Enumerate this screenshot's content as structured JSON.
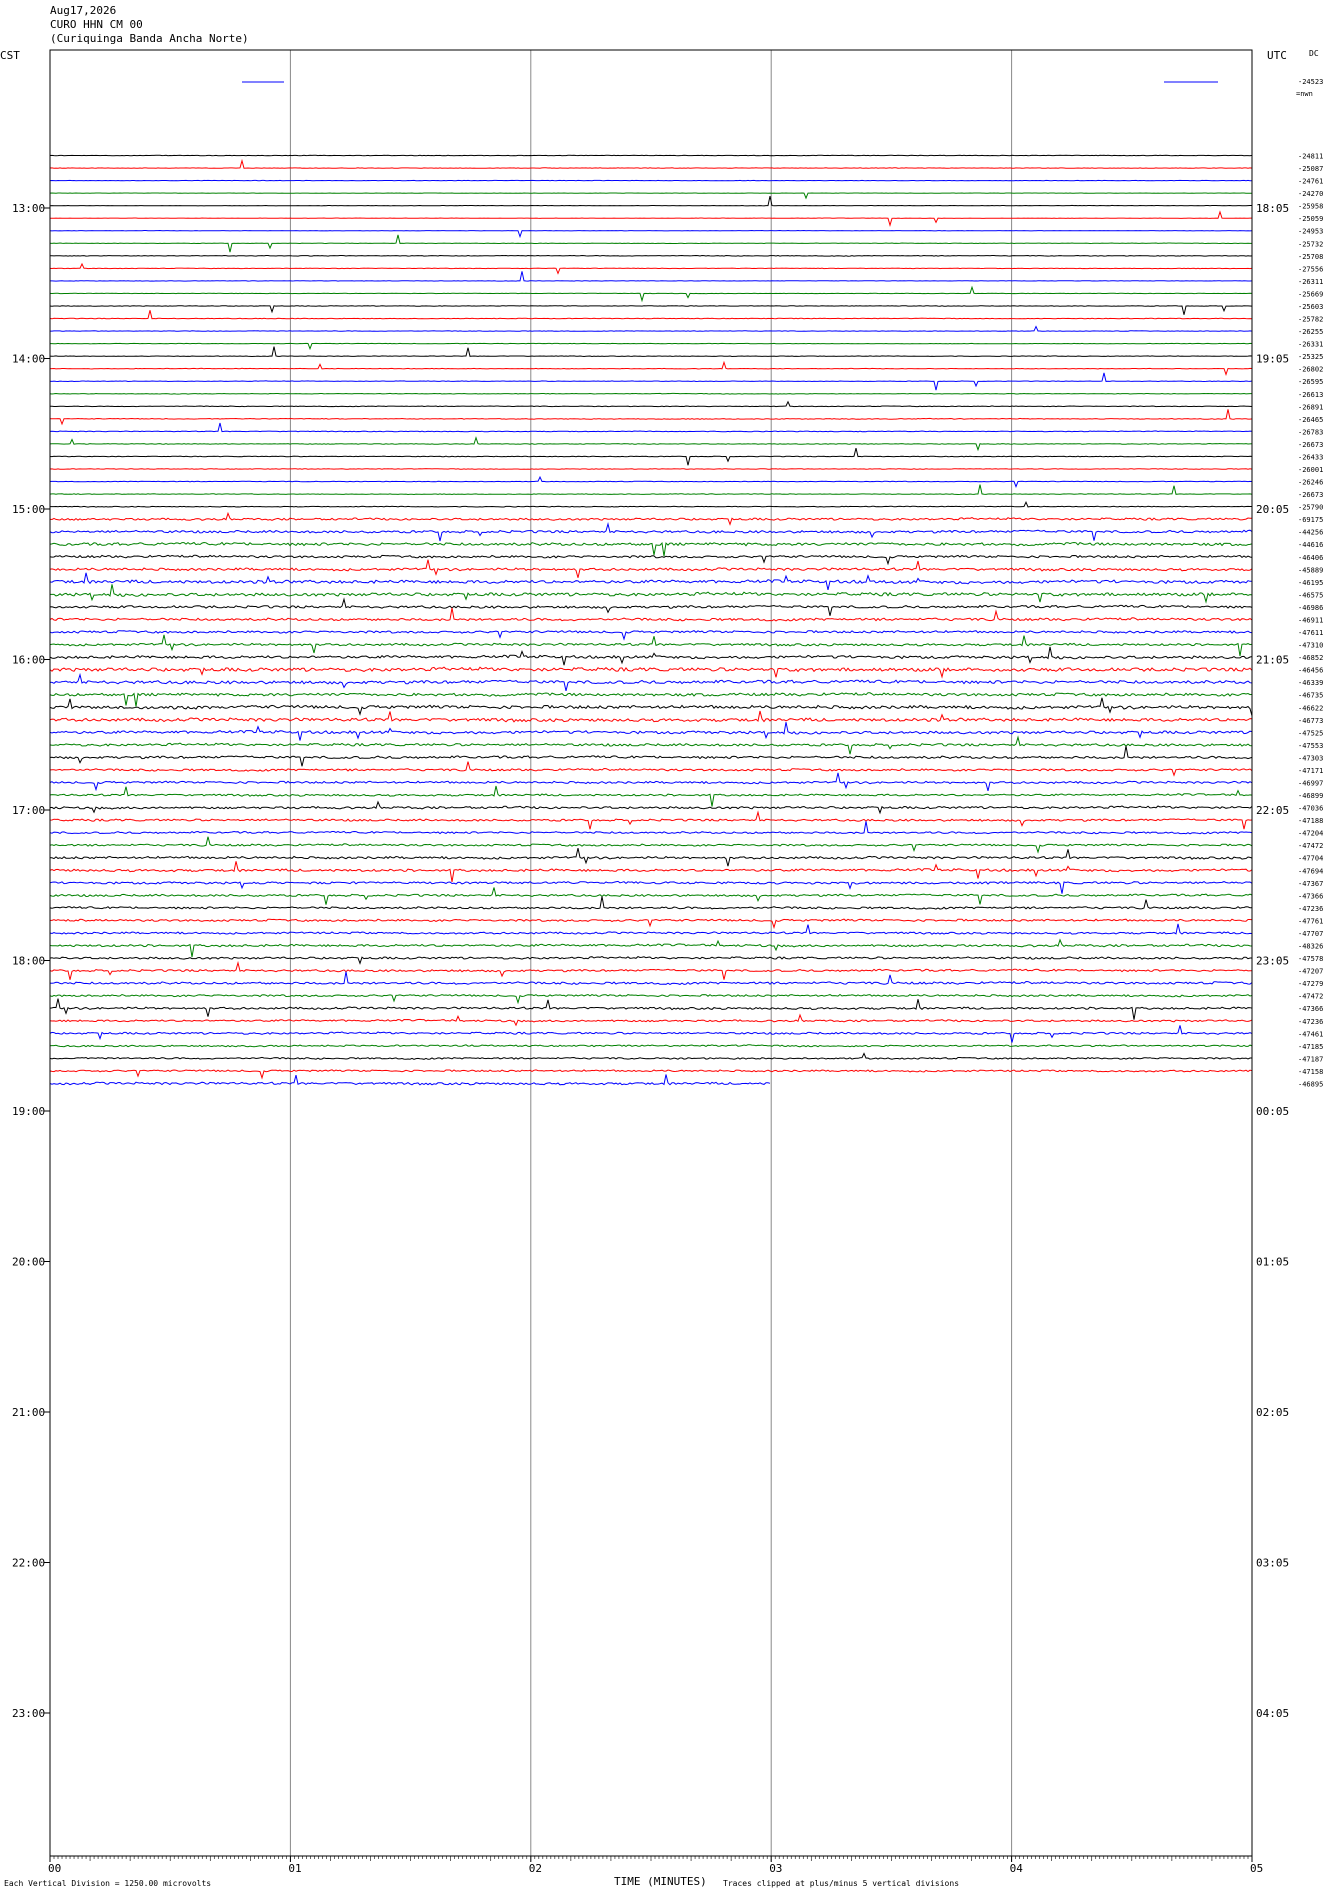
{
  "header": {
    "date": "Aug17,2026",
    "station": "CURO HHN CM 00",
    "name": "(Curiquinga Banda Ancha Norte)"
  },
  "left_zone": "CST",
  "right_zone": "UTC",
  "dc_label": "DC",
  "scale_value": "-24523",
  "scale_unit": "=nwn",
  "footer": {
    "scale": "Each Vertical Division = 1250.00 microvolts",
    "xlabel": "TIME (MINUTES)",
    "clip": "Traces clipped at plus/minus 5 vertical divisions"
  },
  "chart_data": {
    "type": "line",
    "x_ticks": [
      "00",
      "01",
      "02",
      "03",
      "04",
      "05"
    ],
    "xlim": [
      0,
      5
    ],
    "left_hour_labels": [
      "13:00",
      "14:00",
      "15:00",
      "16:00",
      "17:00",
      "18:00",
      "19:00",
      "20:00",
      "21:00",
      "22:00",
      "23:00"
    ],
    "right_hour_labels": [
      "18:05",
      "19:05",
      "20:05",
      "21:05",
      "22:05",
      "23:05",
      "00:05",
      "01:05",
      "02:05",
      "03:05",
      "04:05"
    ],
    "trace_colors": [
      "#000000",
      "#ff0000",
      "#0000ff",
      "#008000"
    ],
    "trace_offsets": [
      "-24811",
      "-25087",
      "-24761",
      "-24270",
      "-25958",
      "-25059",
      "-24953",
      "-25732",
      "-25708",
      "-27556",
      "-26311",
      "-25669",
      "-25603",
      "-25782",
      "-26255",
      "-26331",
      "-25325",
      "-26802",
      "-26595",
      "-26613",
      "-26891",
      "-26465",
      "-26783",
      "-26673",
      "-26433",
      "-26001",
      "-26246",
      "-26673",
      "-25790",
      "-69175",
      "-44256",
      "-44616",
      "-46406",
      "-45889",
      "-46195",
      "-46575",
      "-46986",
      "-46911",
      "-47611",
      "-47310",
      "-46852",
      "-46456",
      "-46339",
      "-46735",
      "-46622",
      "-46773",
      "-47525",
      "-47553",
      "-47303",
      "-47171",
      "-46997",
      "-46899",
      "-47036",
      "-47188",
      "-47204",
      "-47472",
      "-47704",
      "-47694",
      "-47367",
      "-47366",
      "-47236",
      "-47761",
      "-47707",
      "-48326",
      "-47578",
      "-47207",
      "-47279",
      "-47472",
      "-47366",
      "-47236",
      "-47461",
      "-47185",
      "-47187",
      "-47158",
      "-46895"
    ],
    "trace_activity": [
      0.25,
      0.25,
      0.2,
      0.15,
      0.2,
      0.2,
      0.2,
      0.25,
      0.35,
      0.3,
      0.2,
      0.2,
      0.25,
      0.3,
      0.25,
      0.25,
      0.3,
      0.3,
      0.3,
      0.3,
      0.35,
      0.4,
      0.4,
      0.35,
      0.35,
      0.3,
      0.3,
      0.35,
      0.4,
      1.2,
      1.4,
      1.6,
      1.3,
      1.4,
      1.8,
      1.8,
      1.4,
      1.4,
      1.3,
      1.3,
      1.6,
      2.0,
      1.8,
      1.6,
      1.8,
      1.8,
      1.6,
      1.4,
      1.4,
      1.2,
      1.2,
      1.1,
      1.3,
      1.2,
      1.1,
      1.1,
      1.3,
      1.4,
      1.3,
      1.2,
      1.2,
      1.2,
      1.1,
      1.3,
      1.2,
      1.2,
      1.3,
      1.1,
      1.2,
      1.1,
      1.1,
      0.9,
      0.9,
      1.0,
      1.3
    ],
    "last_trace_end_minute": 3.0
  }
}
